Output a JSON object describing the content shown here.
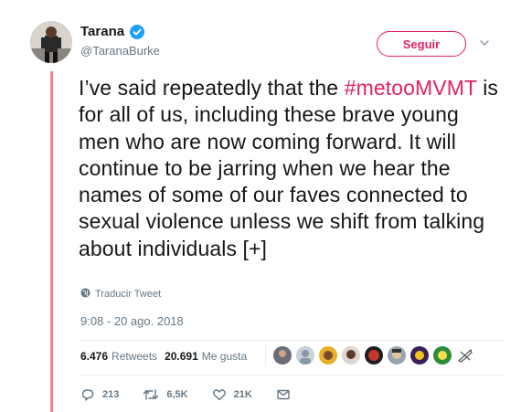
{
  "author": {
    "name": "Tarana",
    "handle": "@TaranaBurke",
    "verified": true
  },
  "follow_button": {
    "label": "Seguir"
  },
  "tweet": {
    "hashtag": "#metooMVMT",
    "text_before": "I’ve said repeatedly that the ",
    "text_after": " is for all of us, including these brave young men who are now coming forward. It will continue to be jarring when we hear the names of some of our faves connected to sexual violence unless we shift from talking about individuals [+]"
  },
  "translate_label": "Traducir Tweet",
  "timestamp": "9:08 - 20 ago. 2018",
  "stats": {
    "retweets_count": "6.476",
    "retweets_label": "Retweets",
    "likes_count": "20.691",
    "likes_label": "Me gusta"
  },
  "actions": {
    "replies": "213",
    "retweets": "6,5K",
    "likes": "21K"
  },
  "colors": {
    "accent": "#e0245e",
    "thread_line": "#e8888c",
    "verified": "#1da1f2",
    "muted": "#657786"
  },
  "icons": [
    "verified-badge-icon",
    "chevron-down-icon",
    "globe-icon",
    "reply-icon",
    "retweet-icon",
    "heart-icon",
    "message-icon"
  ]
}
